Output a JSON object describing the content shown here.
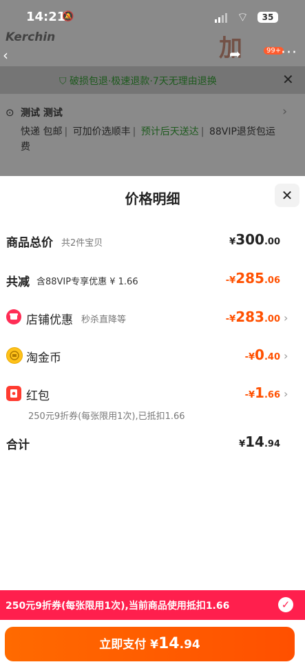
{
  "status_bar": {
    "time": "14:21",
    "battery": "35"
  },
  "header": {
    "brand": "Kerchin",
    "promo_glyph": "加",
    "cart_badge": "99+"
  },
  "guarantee": {
    "text": "破损包退·极速退款·7天无理由退换"
  },
  "address": {
    "name": "测试 测试",
    "shipping": [
      "快递 包邮",
      "可加价选顺丰"
    ],
    "delivery": "预计后天送达",
    "service": "88VIP退货包运费"
  },
  "sheet": {
    "title": "价格明细",
    "total_goods": {
      "label": "商品总价",
      "sub": "共2件宝贝",
      "currency": "¥",
      "int": "300",
      "dec": ".00"
    },
    "reduction": {
      "label": "共减",
      "sub": "含88VIP专享优惠 ¥ 1.66",
      "prefix": "-¥",
      "int": "285",
      "dec": ".06"
    },
    "shop_discount": {
      "label": "店铺优惠",
      "sub": "秒杀直降等",
      "prefix": "-¥",
      "int": "283",
      "dec": ".00"
    },
    "taojinbi": {
      "label": "淘金币",
      "prefix": "-¥",
      "int": "0",
      "dec": ".40"
    },
    "red_packet": {
      "label": "红包",
      "prefix": "-¥",
      "int": "1",
      "dec": ".66",
      "note": "250元9折券(每张限用1次),已抵扣1.66"
    },
    "total": {
      "label": "合计",
      "currency": "¥",
      "int": "14",
      "dec": ".94"
    }
  },
  "promo_bar": {
    "text": "250元9折券(每张限用1次),当前商品使用抵扣1.66"
  },
  "pay_button": {
    "label": "立即支付 ¥",
    "int": "14",
    "dec": ".94"
  },
  "colors": {
    "accent": "#ff5000",
    "promo": "#ff1f4d",
    "green": "#1e5a1e"
  }
}
